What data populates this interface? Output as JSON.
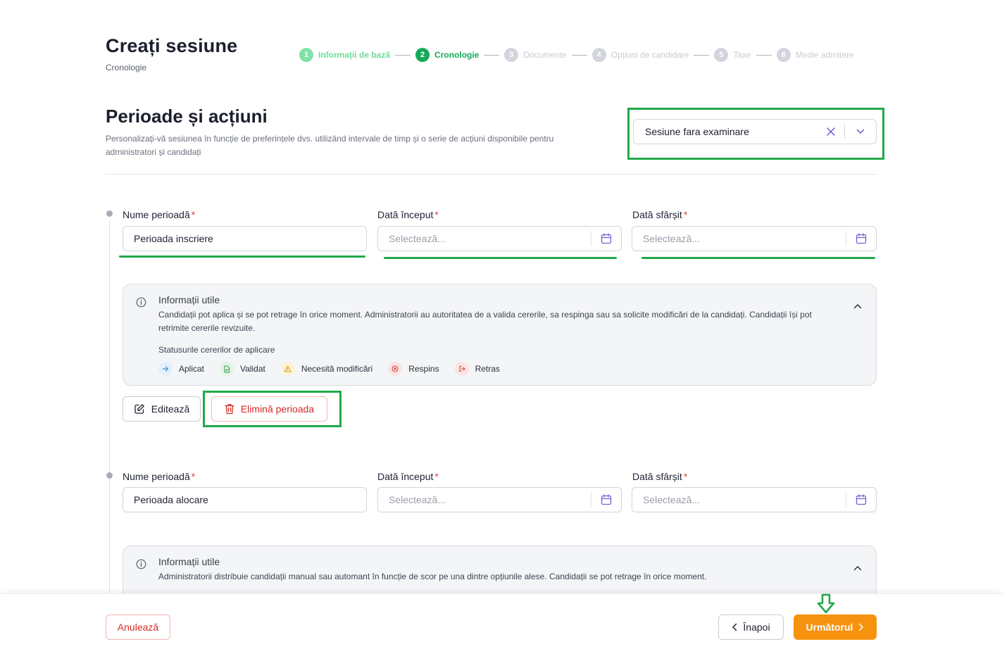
{
  "header": {
    "title": "Creați sesiune",
    "subtitle": "Cronologie"
  },
  "stepper": [
    {
      "num": "1",
      "label": "Informații de bază",
      "state": "done"
    },
    {
      "num": "2",
      "label": "Cronologie",
      "state": "active"
    },
    {
      "num": "3",
      "label": "Documente",
      "state": "pending"
    },
    {
      "num": "4",
      "label": "Opțiuni de candidare",
      "state": "pending"
    },
    {
      "num": "5",
      "label": "Taxe",
      "state": "pending"
    },
    {
      "num": "6",
      "label": "Medie admitere",
      "state": "pending"
    }
  ],
  "section": {
    "title": "Perioade și acțiuni",
    "description": "Personalizați-vă sesiunea în funcție de preferințele dvs. utilizând intervale de timp și o serie de acțiuni disponibile pentru administratori și candidați",
    "session_type": "Sesiune fara examinare"
  },
  "labels": {
    "period_name": "Nume perioadă",
    "start_date": "Dată început",
    "end_date": "Dată sfârșit",
    "required": "*",
    "date_placeholder": "Selectează...",
    "info_title": "Informații utile",
    "statuses_title": "Statusurile cererilor de aplicare"
  },
  "periods": [
    {
      "name": "Perioada inscriere",
      "info_text": "Candidații pot aplica și se pot retrage în orice moment. Administratorii au autoritatea de a valida cererile, sa respinga sau sa solicite modificări de la candidați. Candidații își pot retrimite cererile revizuite.",
      "statuses": [
        {
          "label": "Aplicat",
          "icon": "arrow-right-icon",
          "bg": "#e3f0fb",
          "fg": "#3b8fd9"
        },
        {
          "label": "Validat",
          "icon": "document-check-icon",
          "bg": "#e2f4e3",
          "fg": "#3aa55a"
        },
        {
          "label": "Necesită modificări",
          "icon": "warning-icon",
          "bg": "#fdf4d8",
          "fg": "#d9a417"
        },
        {
          "label": "Respins",
          "icon": "x-circle-icon",
          "bg": "#fbe4e3",
          "fg": "#d9453f"
        },
        {
          "label": "Retras",
          "icon": "logout-icon",
          "bg": "#fbe4e3",
          "fg": "#d9453f"
        }
      ]
    },
    {
      "name": "Perioada alocare",
      "info_text": "Administratorii distribuie candidații manual sau automant în funcție de scor pe una dintre opțiunile alese. Candidații se pot retrage în orice moment."
    }
  ],
  "actions": {
    "edit": "Editează",
    "delete": "Elimină perioada"
  },
  "footer": {
    "cancel": "Anulează",
    "back": "Înapoi",
    "next": "Următorul"
  },
  "colors": {
    "accent_green": "#17a95a",
    "highlight_green": "#22a94a",
    "next_orange": "#f7920f",
    "danger_red": "#d32b27"
  }
}
